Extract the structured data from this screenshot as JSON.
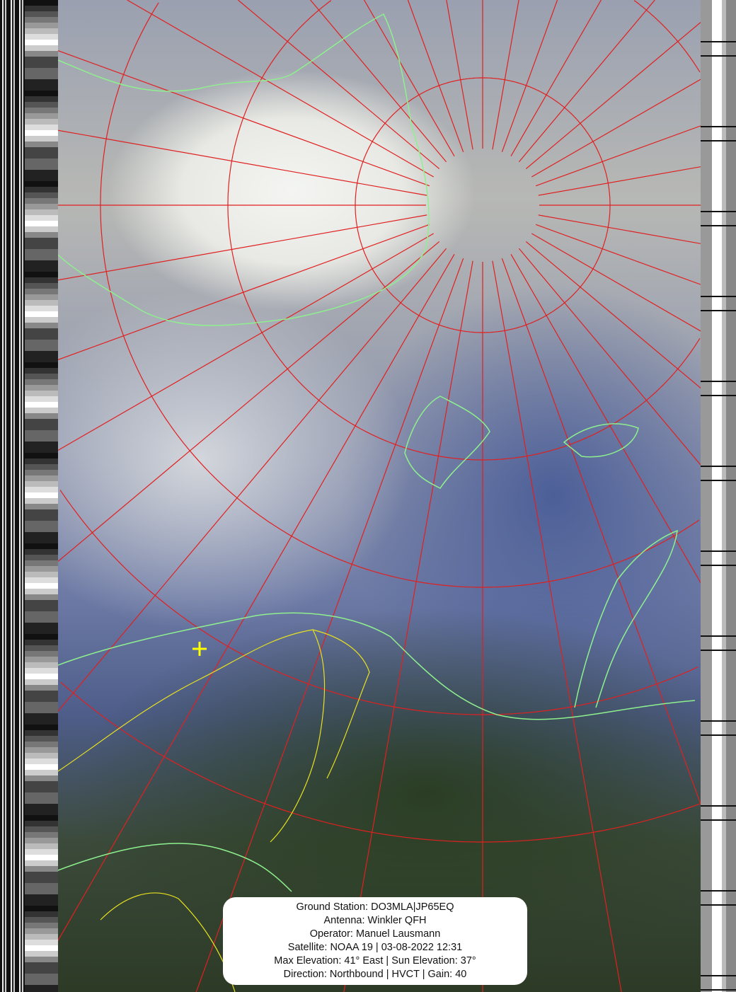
{
  "info_box": {
    "ground_station": "Ground Station: DO3MLA|JP65EQ",
    "antenna": "Antenna: Winkler QFH",
    "operator": "Operator: Manuel Lausmann",
    "satellite": "Satellite: NOAA 19 | 03-08-2022 12:31",
    "elevation": "Max Elevation: 41° East | Sun Elevation: 37°",
    "direction": "Direction: Northbound | HVCT | Gain: 40"
  },
  "colors": {
    "grid": "#e02020",
    "coastline": "#8ef08e",
    "borders": "#e8e020",
    "marker": "#ffff00"
  }
}
